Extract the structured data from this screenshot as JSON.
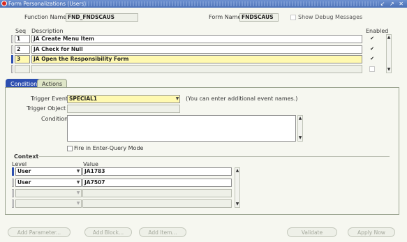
{
  "window": {
    "title": "Form Personalizations (Users)",
    "controls": "↙ ↗ ✕"
  },
  "header": {
    "function_name_label": "Function Name",
    "function_name_value": "FND_FNDSCAUS",
    "form_name_label": "Form Name",
    "form_name_value": "FNDSCAUS",
    "debug_label": "Show Debug Messages"
  },
  "grid": {
    "seq_header": "Seq",
    "description_header": "Description",
    "enabled_header": "Enabled",
    "rows": [
      {
        "seq": "1",
        "description": "JA Create Menu Item",
        "enabled": "✔"
      },
      {
        "seq": "2",
        "description": "JA Check for Null",
        "enabled": "✔"
      },
      {
        "seq": "3",
        "description": "JA Open the Responsibility Form",
        "enabled": "✔"
      },
      {
        "seq": "",
        "description": "",
        "enabled": ""
      }
    ]
  },
  "tabs": [
    {
      "label": "Condition"
    },
    {
      "label": "Actions"
    }
  ],
  "condition": {
    "trigger_event_label": "Trigger Event",
    "trigger_event_value": "SPECIAL1",
    "trigger_hint": "(You can enter additional event names.)",
    "trigger_object_label": "Trigger Object",
    "trigger_object_value": "",
    "condition_label": "Condition",
    "condition_value": "",
    "fire_label": "Fire in Enter-Query Mode"
  },
  "context": {
    "title": "Context",
    "level_header": "Level",
    "value_header": "Value",
    "rows": [
      {
        "level": "User",
        "value": "JA1783"
      },
      {
        "level": "User",
        "value": "JA7507"
      },
      {
        "level": "",
        "value": ""
      },
      {
        "level": "",
        "value": ""
      }
    ]
  },
  "buttons": {
    "add_parameter": "Add Parameter...",
    "add_block": "Add Block...",
    "add_item": "Add Item...",
    "validate": "Validate",
    "apply_now": "Apply Now"
  }
}
